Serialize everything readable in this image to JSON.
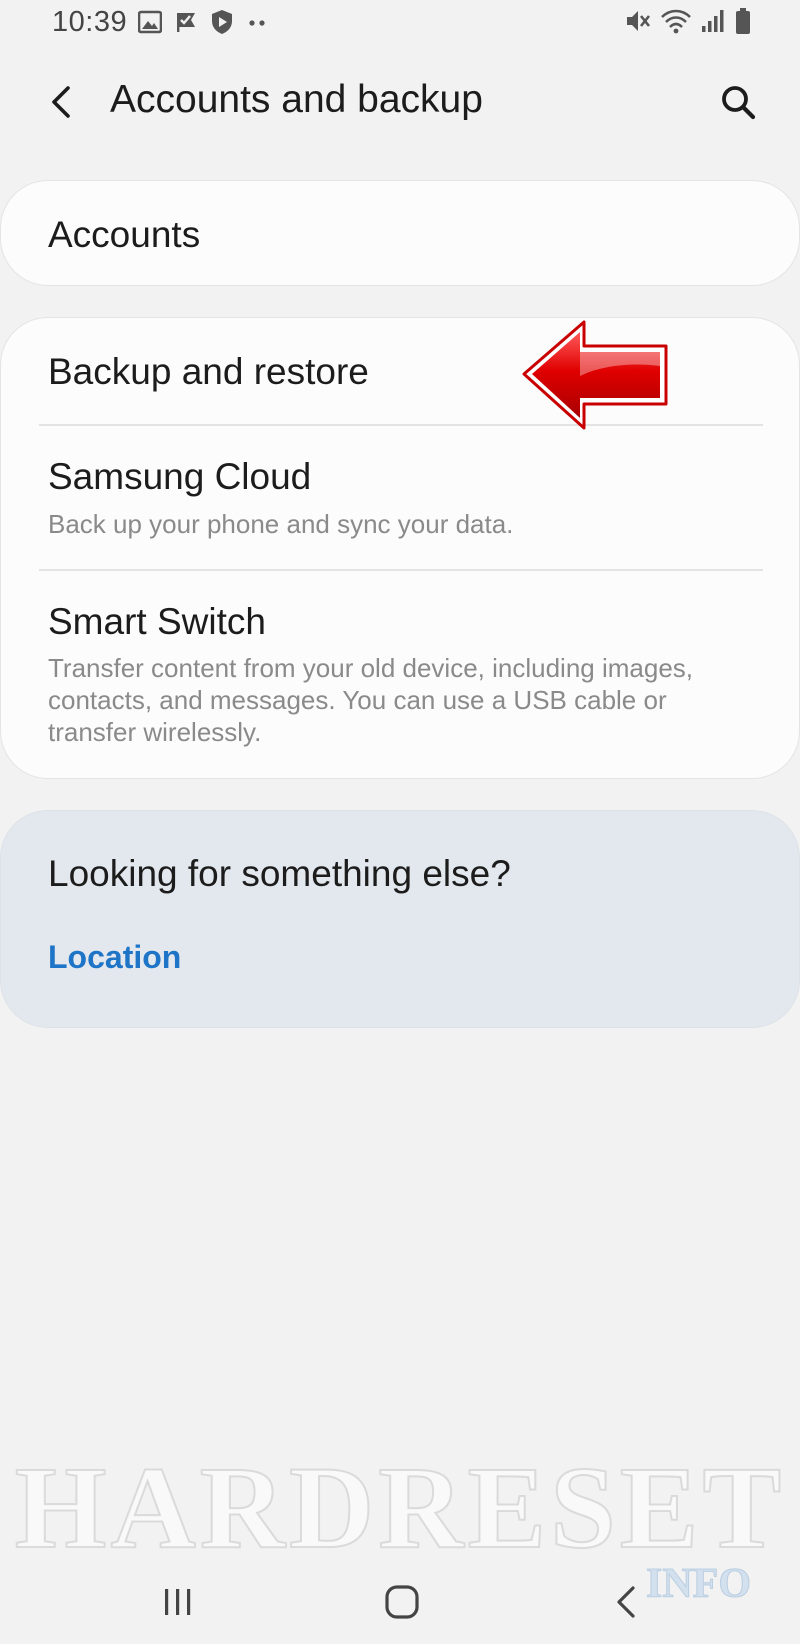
{
  "status_bar": {
    "time": "10:39",
    "left_icons": [
      "gallery-icon",
      "check-flag-icon",
      "shield-icon",
      "more-dots-icon"
    ],
    "right_icons": [
      "mute-icon",
      "wifi-icon",
      "signal-icon",
      "battery-icon"
    ]
  },
  "app_bar": {
    "title": "Accounts and backup",
    "back_icon": "back-chevron-icon",
    "search_icon": "search-icon"
  },
  "sections": {
    "accounts": {
      "title": "Accounts"
    },
    "backup": {
      "items": [
        {
          "title": "Backup and restore",
          "subtitle": ""
        },
        {
          "title": "Samsung Cloud",
          "subtitle": "Back up your phone and sync your data."
        },
        {
          "title": "Smart Switch",
          "subtitle": "Transfer content from your old device, including images, contacts, and messages. You can use a USB cable or transfer wirelessly."
        }
      ]
    }
  },
  "suggestions": {
    "title": "Looking for something else?",
    "link": "Location"
  },
  "watermark": {
    "text": "HARDRESET",
    "sub": "INFO"
  },
  "nav_bar": {
    "recents_icon": "recents-icon",
    "home_icon": "home-icon",
    "back_icon": "back-icon"
  },
  "colors": {
    "background": "#f2f2f2",
    "card": "#fcfcfc",
    "suggestion_card": "#e3e8ee",
    "link": "#1e74c6",
    "subtitle": "#8a8a8a",
    "annotation_arrow": "#d40000"
  }
}
